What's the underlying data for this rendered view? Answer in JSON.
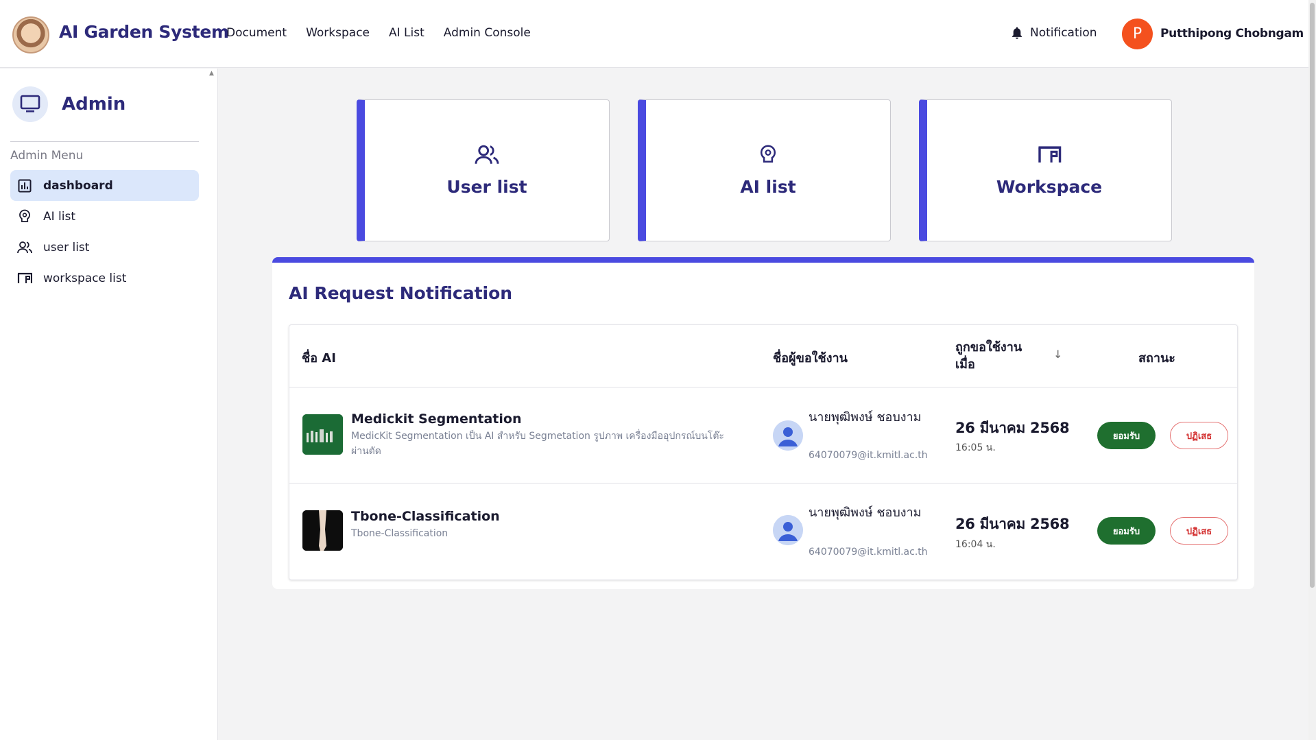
{
  "app": {
    "title": "AI Garden System",
    "logo_icon": "sloth-avatar-logo"
  },
  "nav": {
    "links": [
      "Document",
      "Workspace",
      "AI List",
      "Admin Console"
    ],
    "notification_label": "Notification",
    "user_initial": "P",
    "user_name": "Putthipong Chobngam",
    "avatar_color": "#f4511e"
  },
  "sidebar": {
    "title": "Admin",
    "menu_label": "Admin Menu",
    "items": [
      {
        "label": "dashboard",
        "icon": "dashboard-icon",
        "active": true
      },
      {
        "label": "AI list",
        "icon": "ai-brain-icon",
        "active": false
      },
      {
        "label": "user list",
        "icon": "users-icon",
        "active": false
      },
      {
        "label": "workspace list",
        "icon": "workspace-icon",
        "active": false
      }
    ]
  },
  "cards": [
    {
      "label": "User list",
      "icon": "users-icon"
    },
    {
      "label": "AI list",
      "icon": "ai-brain-icon"
    },
    {
      "label": "Workspace",
      "icon": "workspace-icon"
    }
  ],
  "notifications": {
    "title": "AI Request Notification",
    "columns": {
      "ai_name": "ชื่อ AI",
      "requester": "ชื่อผู้ขอใช้งาน",
      "requested_at": "ถูกขอใช้งานเมื่อ",
      "status": "สถานะ"
    },
    "rows": [
      {
        "ai_name": "Medickit Segmentation",
        "ai_desc": "MedicKit Segmentation เป็น AI สำหรับ Segmetation รูปภาพ เครื่องมืออุปกรณ์บนโต๊ะผ่านตัด",
        "user_name": "นายพุฒิพงษ์ ชอบงาม",
        "user_email": "64070079@it.kmitl.ac.th",
        "date": "26 มีนาคม 2568",
        "time": "16:05 น.",
        "accept_label": "ยอมรับ",
        "reject_label": "ปฏิเสธ"
      },
      {
        "ai_name": "Tbone-Classification",
        "ai_desc": "Tbone-Classification",
        "user_name": "นายพุฒิพงษ์ ชอบงาม",
        "user_email": "64070079@it.kmitl.ac.th",
        "date": "26 มีนาคม 2568",
        "time": "16:04 น.",
        "accept_label": "ยอมรับ",
        "reject_label": "ปฏิเสธ"
      }
    ]
  },
  "colors": {
    "brand": "#2d2a7a",
    "accent": "#4a4ae0",
    "accept": "#1f6f2f",
    "reject": "#d32f2f",
    "sidebar_active": "#dbe7fb"
  }
}
